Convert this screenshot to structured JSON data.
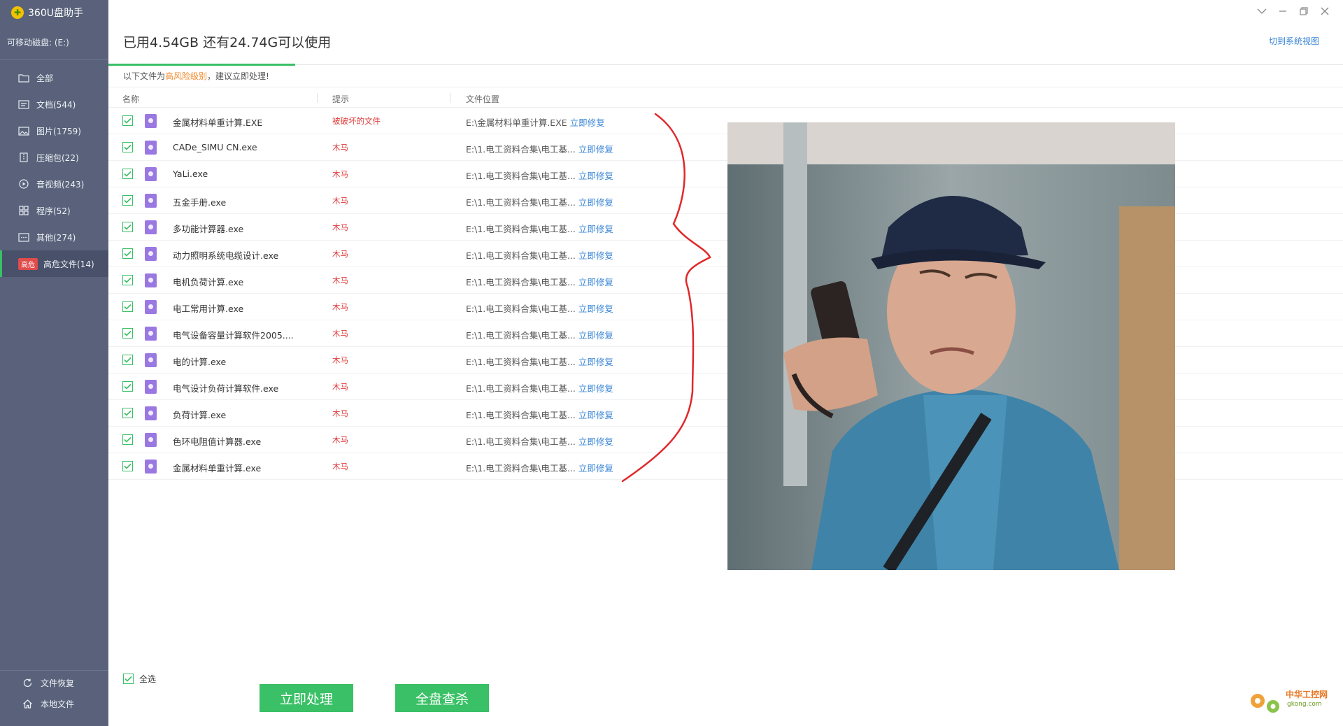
{
  "app": {
    "title": "360U盘助手",
    "drive": "可移动磁盘: (E:)"
  },
  "header": {
    "storage": "已用4.54GB 还有24.74G可以使用",
    "sys_view": "切到系统视图"
  },
  "sidebar": {
    "items": [
      {
        "label": "全部",
        "icon": "folder-icon"
      },
      {
        "label": "文档(544)",
        "icon": "document-icon"
      },
      {
        "label": "图片(1759)",
        "icon": "image-icon"
      },
      {
        "label": "压缩包(22)",
        "icon": "archive-icon"
      },
      {
        "label": "音视频(243)",
        "icon": "play-icon"
      },
      {
        "label": "程序(52)",
        "icon": "grid-icon"
      },
      {
        "label": "其他(274)",
        "icon": "more-icon"
      },
      {
        "label": "高危文件(14)",
        "badge": "高危",
        "active": true
      }
    ],
    "bottom": [
      {
        "label": "文件恢复",
        "icon": "refresh-icon"
      },
      {
        "label": "本地文件",
        "icon": "home-icon"
      }
    ]
  },
  "warning": {
    "prefix": "以下文件为",
    "highlight": "高风险级别",
    "suffix": "，建议立即处理!"
  },
  "table": {
    "headers": {
      "name": "名称",
      "tip": "提示",
      "location": "文件位置"
    },
    "repair_label": "立即修复",
    "rows": [
      {
        "name": "金属材料单重计算.EXE",
        "tip": "被破坏的文件",
        "path": "E:\\金属材料单重计算.EXE"
      },
      {
        "name": "CADe_SIMU CN.exe",
        "tip": "木马",
        "path": "E:\\1.电工资料合集\\电工基..."
      },
      {
        "name": "YaLi.exe",
        "tip": "木马",
        "path": "E:\\1.电工资料合集\\电工基..."
      },
      {
        "name": "五金手册.exe",
        "tip": "木马",
        "path": "E:\\1.电工资料合集\\电工基..."
      },
      {
        "name": "多功能计算器.exe",
        "tip": "木马",
        "path": "E:\\1.电工资料合集\\电工基..."
      },
      {
        "name": "动力照明系统电缆设计.exe",
        "tip": "木马",
        "path": "E:\\1.电工资料合集\\电工基..."
      },
      {
        "name": "电机负荷计算.exe",
        "tip": "木马",
        "path": "E:\\1.电工资料合集\\电工基..."
      },
      {
        "name": "电工常用计算.exe",
        "tip": "木马",
        "path": "E:\\1.电工资料合集\\电工基..."
      },
      {
        "name": "电气设备容量计算软件2005....",
        "tip": "木马",
        "path": "E:\\1.电工资料合集\\电工基..."
      },
      {
        "name": "电的计算.exe",
        "tip": "木马",
        "path": "E:\\1.电工资料合集\\电工基..."
      },
      {
        "name": "电气设计负荷计算软件.exe",
        "tip": "木马",
        "path": "E:\\1.电工资料合集\\电工基..."
      },
      {
        "name": "负荷计算.exe",
        "tip": "木马",
        "path": "E:\\1.电工资料合集\\电工基..."
      },
      {
        "name": "色环电阻值计算器.exe",
        "tip": "木马",
        "path": "E:\\1.电工资料合集\\电工基..."
      },
      {
        "name": "金属材料单重计算.exe",
        "tip": "木马",
        "path": "E:\\1.电工资料合集\\电工基..."
      }
    ]
  },
  "footer": {
    "select_all": "全选",
    "process": "立即处理",
    "full_scan": "全盘查杀"
  },
  "watermark": {
    "text": "中华工控网",
    "sub": "gkong.com"
  },
  "colors": {
    "sidebar": "#59627a",
    "accent": "#3ac066",
    "link": "#3a86d6",
    "danger": "#e03c3c",
    "highlight": "#f08c2e"
  }
}
